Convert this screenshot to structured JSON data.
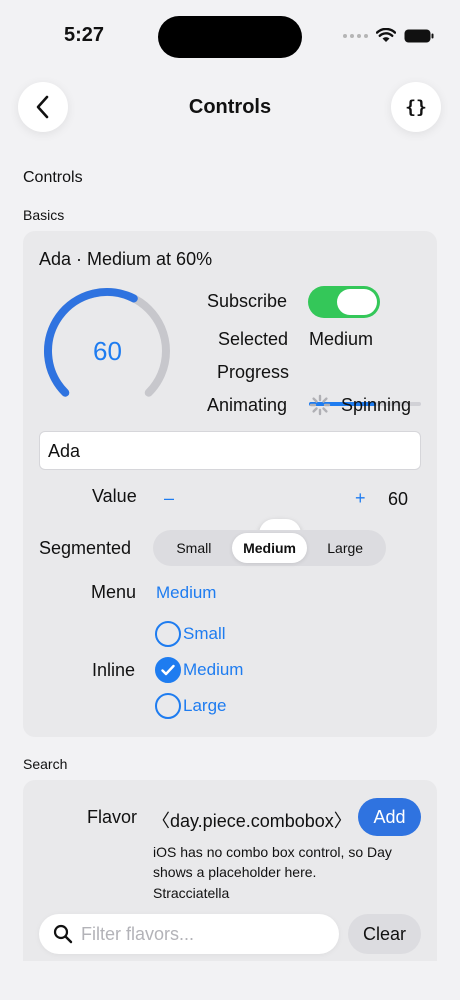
{
  "status": {
    "time": "5:27"
  },
  "nav": {
    "title": "Controls",
    "back_icon": "chevron-left-icon",
    "code_icon": "braces-icon"
  },
  "page": {
    "heading": "Controls"
  },
  "basics": {
    "section_label": "Basics",
    "summary": "Ada · Medium at 60%",
    "gauge": {
      "value": 60,
      "display": "60"
    },
    "subscribe": {
      "label": "Subscribe",
      "on": true
    },
    "selected": {
      "label": "Selected",
      "value": "Medium"
    },
    "progress": {
      "label": "Progress",
      "value": 0.6
    },
    "animating": {
      "label": "Animating",
      "value": "Spinning"
    },
    "name_field": {
      "value": "Ada"
    },
    "value_slider": {
      "label": "Value",
      "minus": "–",
      "plus": "+",
      "value": 60,
      "display": "60",
      "fraction": 0.6
    },
    "segmented": {
      "label": "Segmented",
      "options": [
        "Small",
        "Medium",
        "Large"
      ],
      "selected": "Medium"
    },
    "menu": {
      "label": "Menu",
      "value": "Medium"
    },
    "inline": {
      "label": "Inline",
      "options": [
        "Small",
        "Medium",
        "Large"
      ],
      "selected": "Medium"
    }
  },
  "search": {
    "section_label": "Search",
    "flavor": {
      "label": "Flavor",
      "placeholder_text": "〈day.piece.combobox〉",
      "add_label": "Add"
    },
    "note": "iOS has no combo box control, so Day shows a placeholder here.",
    "item": "Stracciatella",
    "filter": {
      "placeholder": "Filter flavors...",
      "clear_label": "Clear"
    }
  },
  "colors": {
    "accent": "#1e7cf0",
    "switch_on": "#34c759",
    "add_button": "#2f73e0"
  }
}
